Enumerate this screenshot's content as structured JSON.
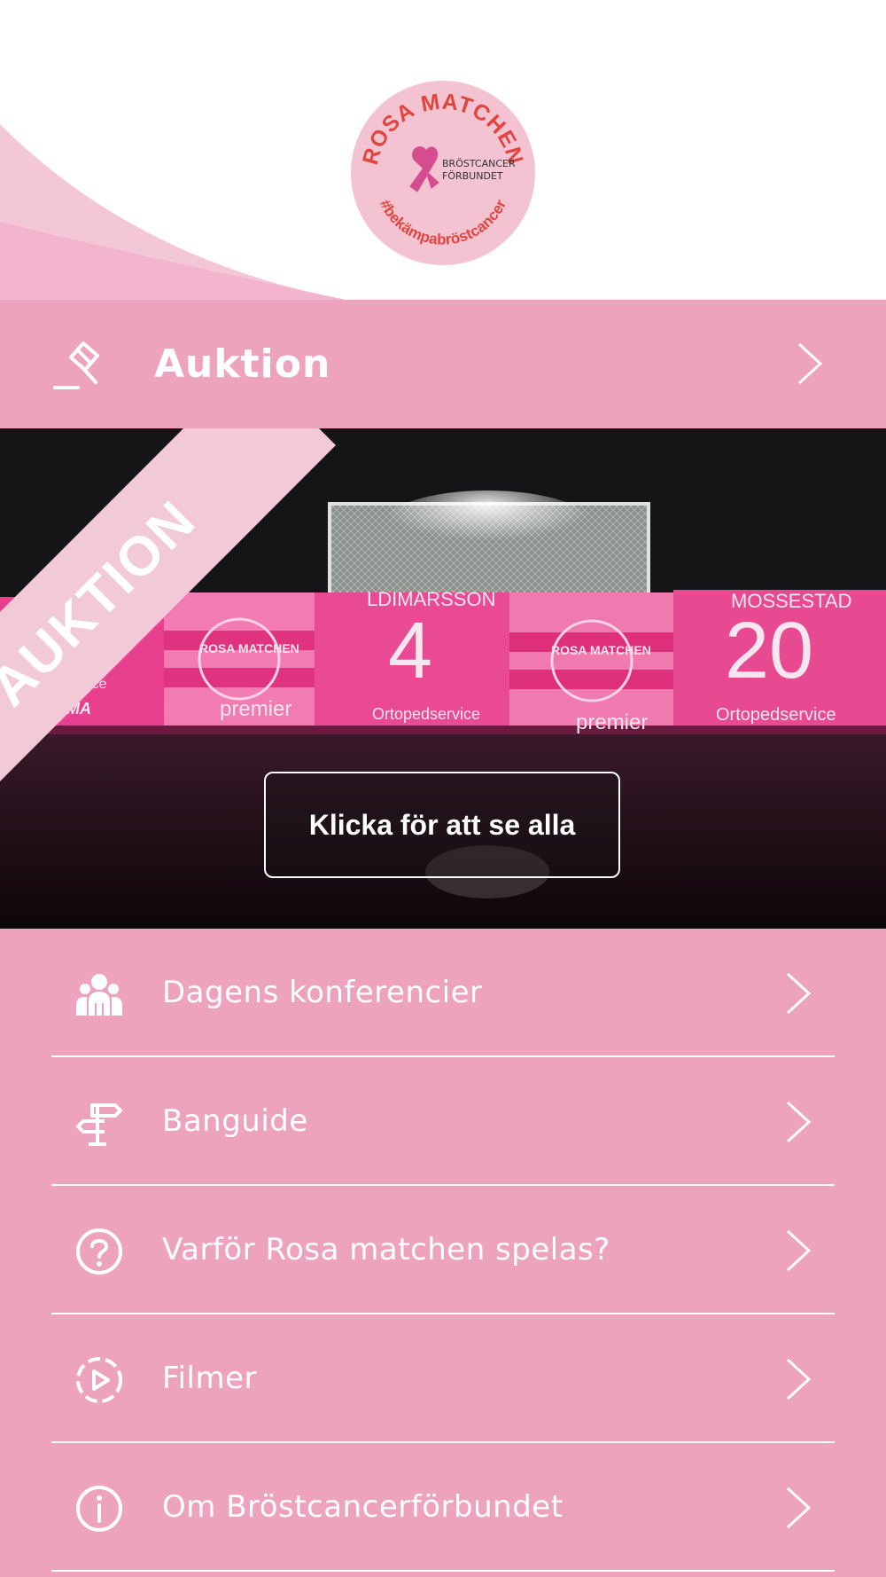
{
  "header": {
    "logo": {
      "top_text": "ROSA MATCHEN",
      "org_line1": "BRÖSTCANCER",
      "org_line2": "FÖRBUNDET",
      "hashtag": "#bekämpabröstcancer"
    }
  },
  "auktion": {
    "title": "Auktion",
    "icon": "gavel-icon"
  },
  "banner": {
    "ribbon_text": "AUKTION",
    "see_all_label": "Klicka för att se alla",
    "jerseys": {
      "name_left": "LDIMARSSON",
      "number_left": "4",
      "name_right": "MOSSESTAD",
      "number_right": "20",
      "sponsor_premier": "premier",
      "sponsor_ortoped": "Ortopedservice",
      "sponsor_sigma": "SIGMA",
      "club_text": "ROSA MATCHEN",
      "partial_left": "edservice"
    }
  },
  "menu": {
    "items": [
      {
        "label": "Dagens konferencier",
        "icon": "people-icon"
      },
      {
        "label": "Banguide",
        "icon": "signpost-icon"
      },
      {
        "label": "Varför Rosa matchen spelas?",
        "icon": "question-circle-icon"
      },
      {
        "label": "Filmer",
        "icon": "play-circle-icon"
      },
      {
        "label": "Om Bröstcancerförbundet",
        "icon": "info-circle-icon"
      }
    ]
  },
  "colors": {
    "pink": "#eda3bc",
    "light_pink": "#f2c9d6",
    "logo_red": "#e0453e",
    "jersey_pink": "#e83f8f"
  }
}
